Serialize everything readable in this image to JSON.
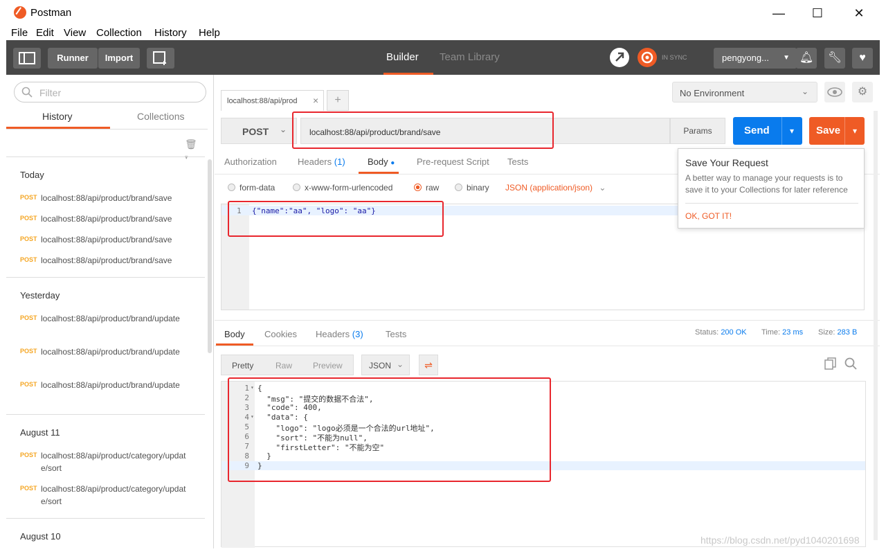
{
  "window": {
    "title": "Postman",
    "minimize": "—",
    "maximize": "☐",
    "close": "✕"
  },
  "menu": [
    "File",
    "Edit",
    "View",
    "Collection",
    "History",
    "Help"
  ],
  "toolbar": {
    "runner": "Runner",
    "import": "Import",
    "tabs": {
      "builder": "Builder",
      "team_library": "Team Library"
    },
    "sync_status": "IN SYNC",
    "user": "pengyong..."
  },
  "sidebar": {
    "filter_placeholder": "Filter",
    "tabs": {
      "history": "History",
      "collections": "Collections"
    },
    "groups": [
      {
        "label": "Today",
        "items": [
          {
            "method": "POST",
            "url": "localhost:88/api/product/brand/save"
          },
          {
            "method": "POST",
            "url": "localhost:88/api/product/brand/save"
          },
          {
            "method": "POST",
            "url": "localhost:88/api/product/brand/save"
          },
          {
            "method": "POST",
            "url": "localhost:88/api/product/brand/save"
          }
        ]
      },
      {
        "label": "Yesterday",
        "items": [
          {
            "method": "POST",
            "url": "localhost:88/api/product/brand/update"
          },
          {
            "method": "POST",
            "url": "localhost:88/api/product/brand/update"
          },
          {
            "method": "POST",
            "url": "localhost:88/api/product/brand/update"
          }
        ]
      },
      {
        "label": "August 11",
        "items": [
          {
            "method": "POST",
            "url": "localhost:88/api/product/category/update/sort"
          },
          {
            "method": "POST",
            "url": "localhost:88/api/product/category/update/sort"
          }
        ]
      },
      {
        "label": "August 10",
        "items": []
      }
    ]
  },
  "request": {
    "tab_label": "localhost:88/api/prod",
    "add_tab": "+",
    "environment": "No Environment",
    "method": "POST",
    "url": "localhost:88/api/product/brand/save",
    "params": "Params",
    "send": "Send",
    "save": "Save",
    "subtabs": {
      "authorization": "Authorization",
      "headers": "Headers",
      "headers_count": "(1)",
      "body": "Body",
      "pre_request": "Pre-request Script",
      "tests": "Tests"
    },
    "body_modes": {
      "form_data": "form-data",
      "urlencoded": "x-www-form-urlencoded",
      "raw": "raw",
      "binary": "binary"
    },
    "content_type": "JSON (application/json)",
    "body_line_no": "1",
    "body_text": "{\"name\":\"aa\", \"logo\": \"aa\"}"
  },
  "popover": {
    "title": "Save Your Request",
    "body": "A better way to manage your requests is to save it to your Collections for later reference",
    "action": "OK, GOT IT!"
  },
  "response": {
    "tabs": {
      "body": "Body",
      "cookies": "Cookies",
      "headers": "Headers",
      "headers_count": "(3)",
      "tests": "Tests"
    },
    "status_label": "Status:",
    "status": "200 OK",
    "time_label": "Time:",
    "time": "23 ms",
    "size_label": "Size:",
    "size": "283 B",
    "view_modes": {
      "pretty": "Pretty",
      "raw": "Raw",
      "preview": "Preview"
    },
    "format": "JSON",
    "lines": [
      {
        "n": "1",
        "text": "{"
      },
      {
        "n": "2",
        "text": "  \"msg\": \"提交的数据不合法\","
      },
      {
        "n": "3",
        "text": "  \"code\": 400,"
      },
      {
        "n": "4",
        "text": "  \"data\": {"
      },
      {
        "n": "5",
        "text": "    \"logo\": \"logo必须是一个合法的url地址\","
      },
      {
        "n": "6",
        "text": "    \"sort\": \"不能为null\","
      },
      {
        "n": "7",
        "text": "    \"firstLetter\": \"不能为空\""
      },
      {
        "n": "8",
        "text": "  }"
      },
      {
        "n": "9",
        "text": "}"
      }
    ]
  },
  "watermark": "https://blog.csdn.net/pyd1040201698",
  "colors": {
    "accent": "#ef5b25",
    "send": "#097bed",
    "toolbar": "#474747",
    "highlight_box": "#e8262d"
  }
}
